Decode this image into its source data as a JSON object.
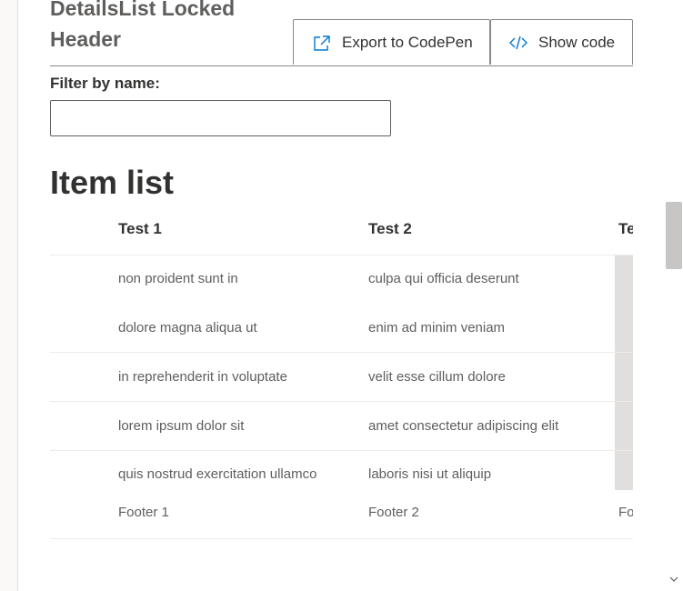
{
  "example": {
    "title_line1": "DetailsList Locked",
    "title_line2": "Header",
    "export_label": "Export to CodePen",
    "code_label": "Show code"
  },
  "filter": {
    "label": "Filter by name:",
    "value": "",
    "placeholder": ""
  },
  "list": {
    "heading": "Item list",
    "columns": [
      "Test 1",
      "Test 2",
      "Te"
    ],
    "rows": [
      [
        "non proident sunt in",
        "culpa qui officia deserunt"
      ],
      [
        "dolore magna aliqua ut",
        "enim ad minim veniam"
      ],
      [
        "in reprehenderit in voluptate",
        "velit esse cillum dolore"
      ],
      [
        "lorem ipsum dolor sit",
        "amet consectetur adipiscing elit"
      ],
      [
        "quis nostrud exercitation ullamco",
        "laboris nisi ut aliquip"
      ]
    ],
    "footer": [
      "Footer 1",
      "Footer 2",
      "Fo"
    ]
  },
  "icons": {
    "export": "share-icon",
    "code": "code-icon",
    "scroll_down": "chevron-down-icon"
  },
  "colors": {
    "text_primary": "#323130",
    "text_secondary": "#605e5c",
    "border": "#8a8886",
    "scroll_thumb": "#c8c6c4"
  }
}
